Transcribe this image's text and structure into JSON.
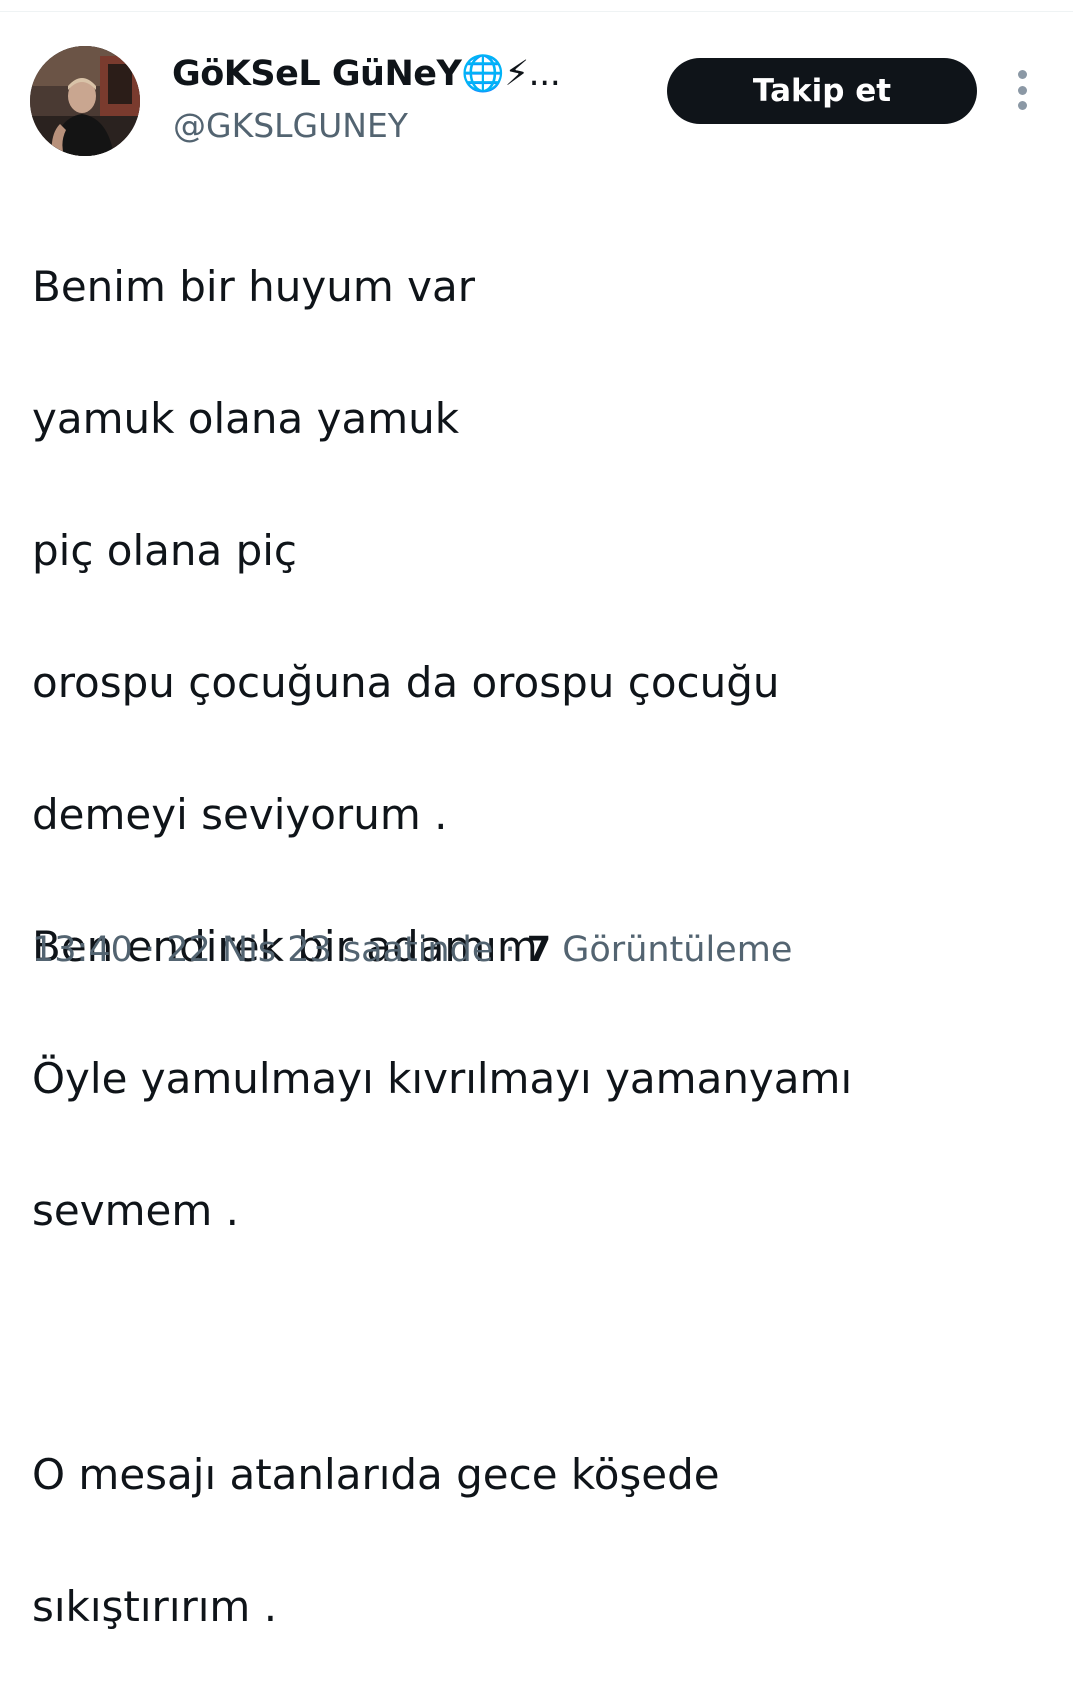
{
  "user": {
    "display_name": "GöKSeL GüNeY",
    "display_name_suffix": "🌐⚡...",
    "handle": "@GKSLGUNEY",
    "avatar_icon": "profile-photo"
  },
  "actions": {
    "follow_label": "Takip et",
    "more_icon": "vertical-ellipsis-icon"
  },
  "tweet": {
    "lines": [
      "Benim bir huyum var",
      "yamuk olana yamuk",
      "piç olana piç",
      "orospu çocuğuna da orospu çocuğu",
      "demeyi seviyorum .",
      "Ben endirek bir adamım",
      "Öyle yamulmayı kıvrılmayı yamanyamı",
      "sevmem .",
      "",
      "O mesajı atanlarıda gece köşede",
      "sıkıştırırım ."
    ]
  },
  "meta": {
    "time": "13:40",
    "separator": " · ",
    "date": "22 Nis 23 saatinde",
    "views_count": "7",
    "views_label": "Görüntüleme"
  },
  "colors": {
    "text_primary": "#0f1419",
    "text_secondary": "#536471",
    "follow_bg": "#0f1419",
    "follow_text": "#ffffff"
  }
}
